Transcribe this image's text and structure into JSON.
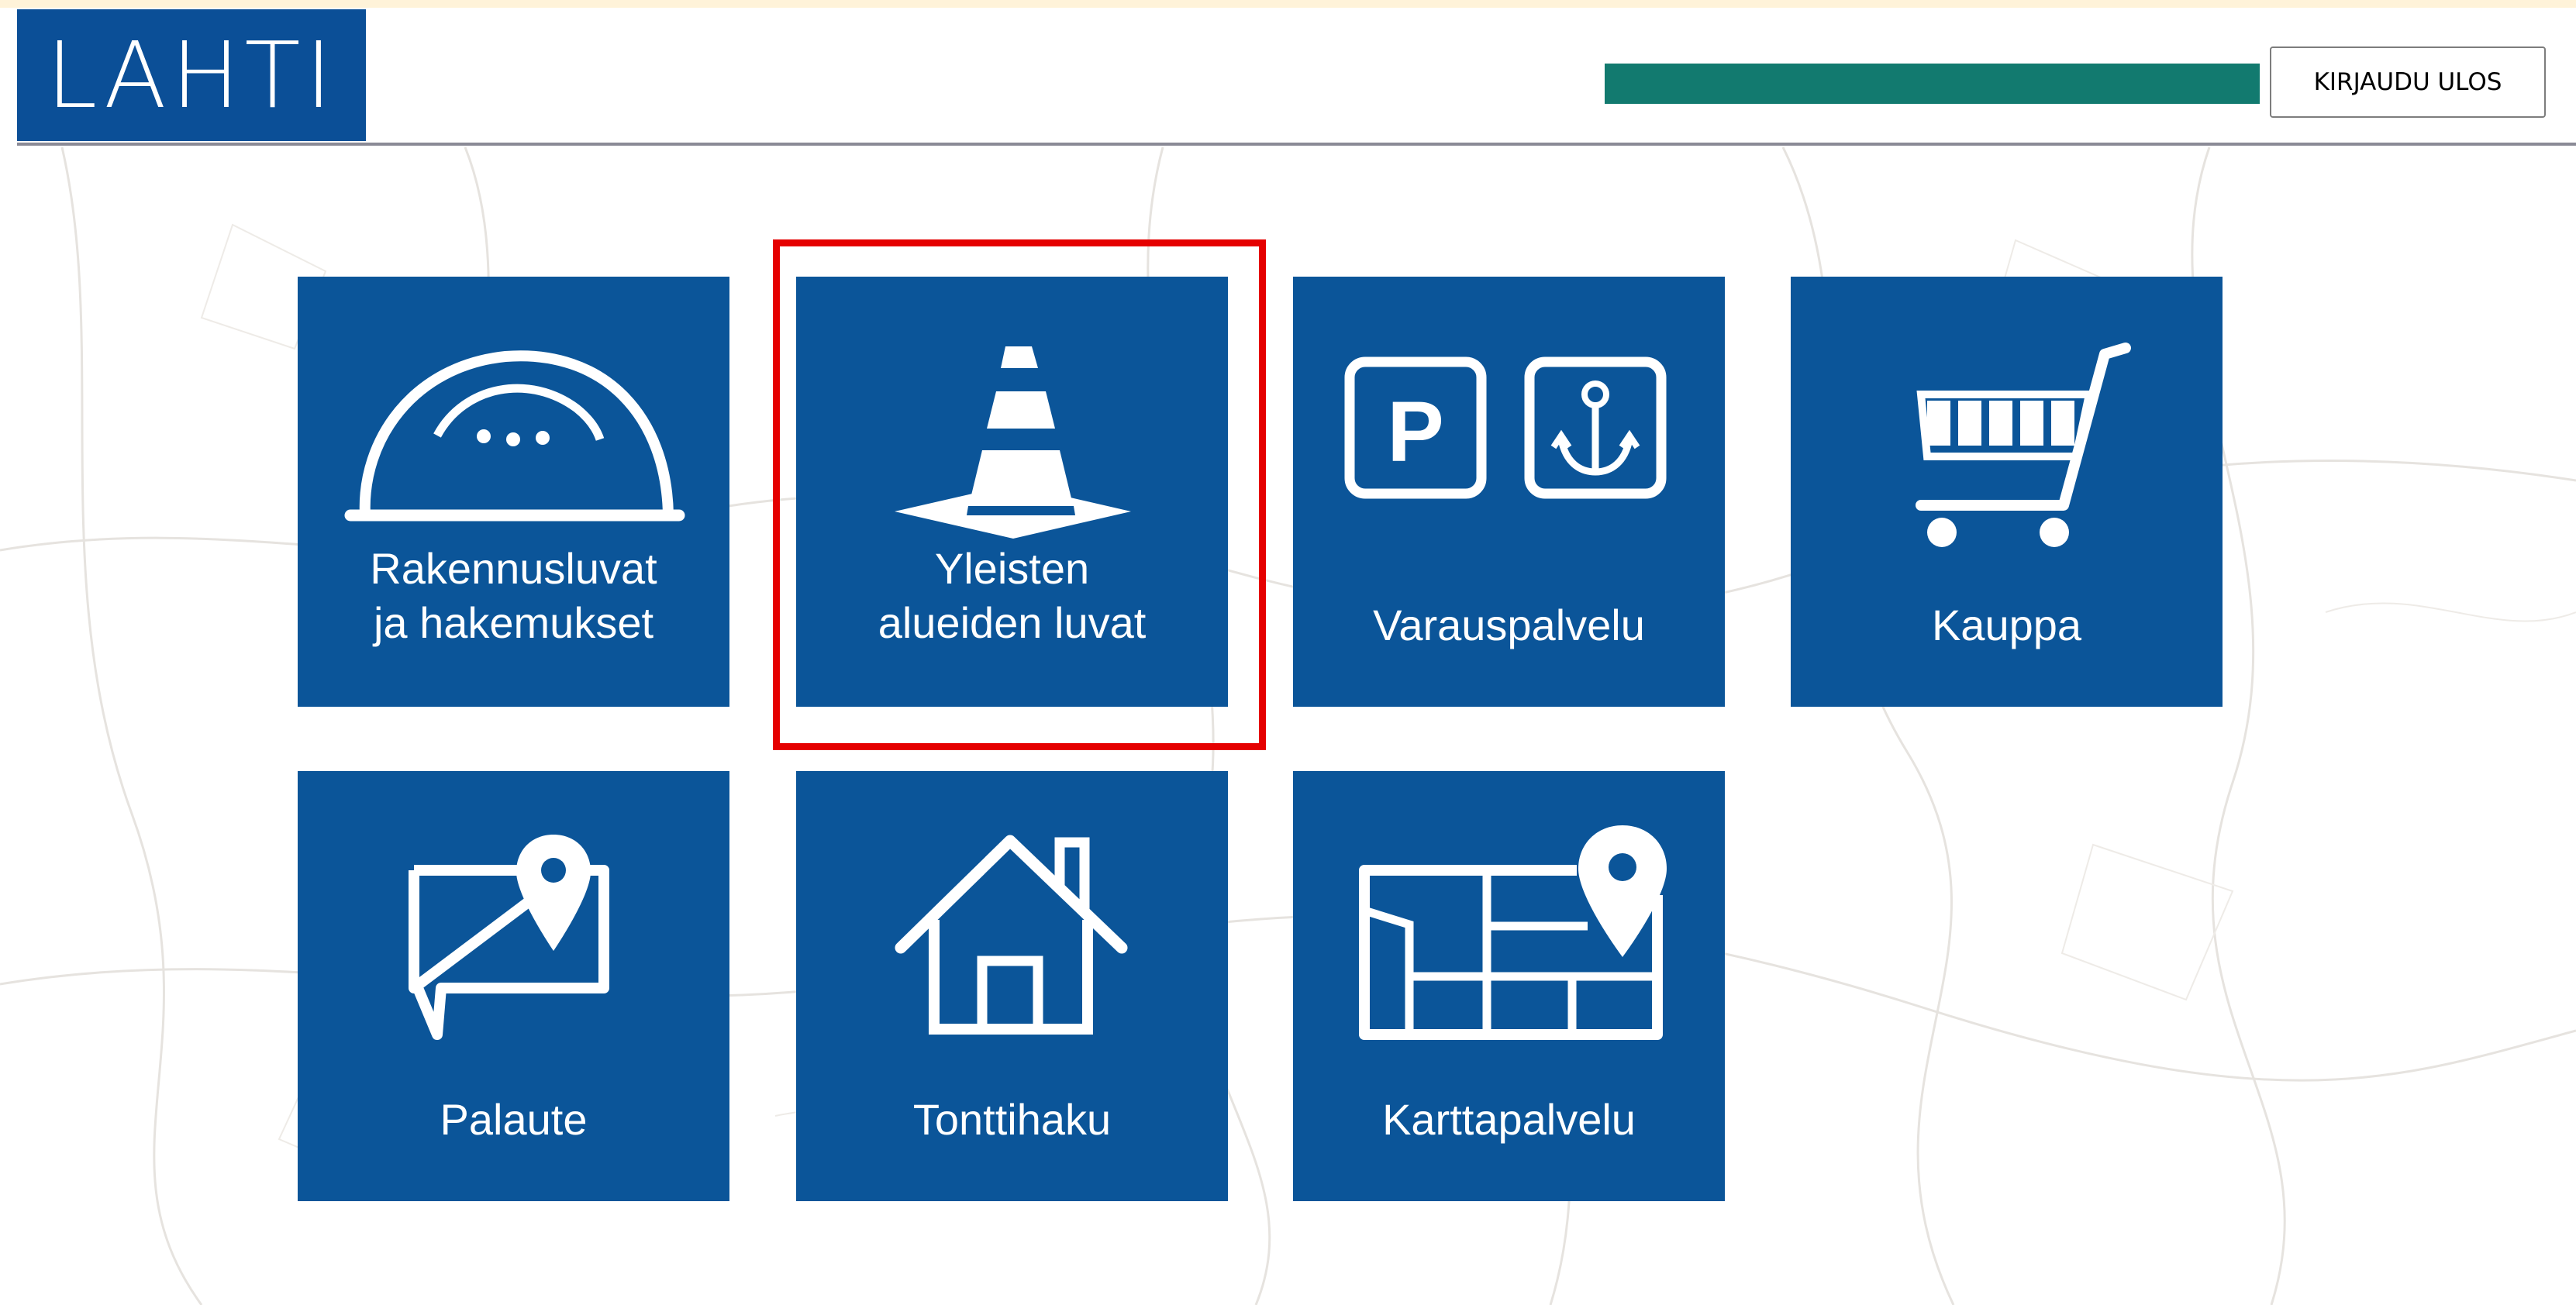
{
  "header": {
    "logo_text": "LAHTI",
    "logout_label": "KIRJAUDU ULOS",
    "accent_color": "#127a6f",
    "brand_color": "#0b4f97"
  },
  "tiles": [
    {
      "label": "Rakennusluvat\nja hakemukset",
      "icon": "hard-hat-icon"
    },
    {
      "label": "Yleisten\nalueiden luvat",
      "icon": "traffic-cone-icon"
    },
    {
      "label": "Varauspalvelu",
      "icon": "parking-anchor-icon"
    },
    {
      "label": "Kauppa",
      "icon": "shopping-cart-icon"
    },
    {
      "label": "Palaute",
      "icon": "feedback-pin-icon"
    },
    {
      "label": "Tonttihaku",
      "icon": "house-icon"
    },
    {
      "label": "Karttapalvelu",
      "icon": "map-pin-icon"
    }
  ],
  "highlight_color": "#e50000"
}
